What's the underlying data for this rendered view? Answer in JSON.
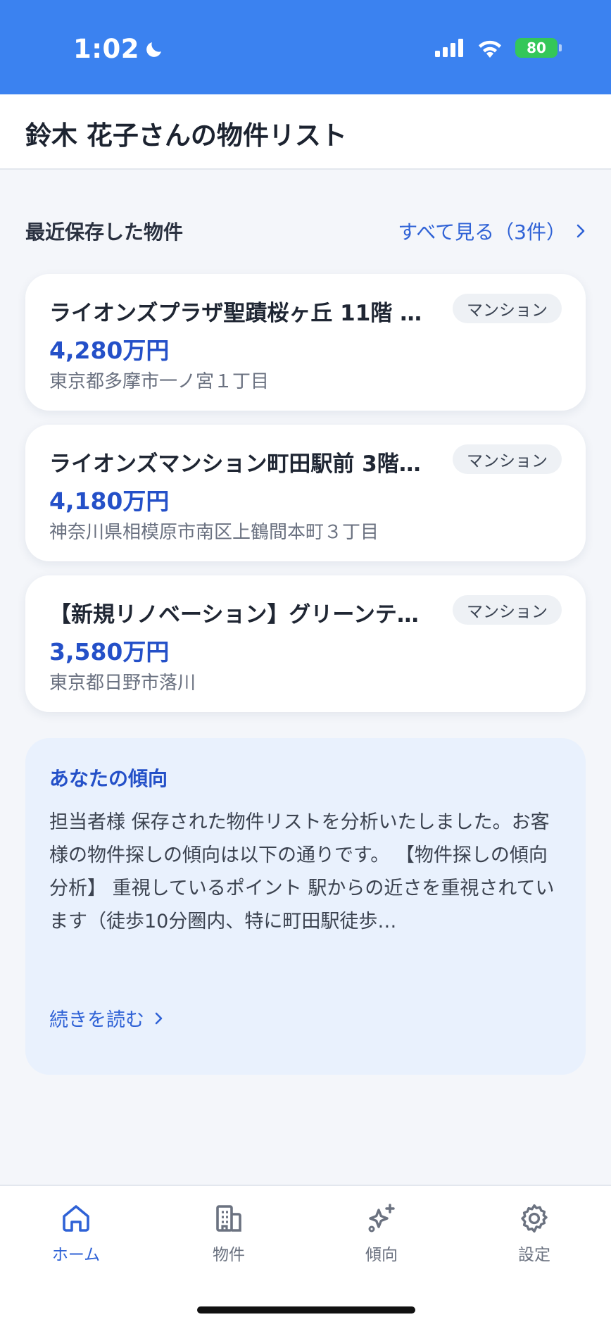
{
  "status_bar": {
    "time": "1:02",
    "battery": "80"
  },
  "header": {
    "title": "鈴木 花子さんの物件リスト"
  },
  "recent": {
    "title": "最近保存した物件",
    "see_all": "すべて見る（3件）",
    "items": [
      {
        "title": "ライオンズプラザ聖蹟桜ヶ丘 11階 …",
        "badge": "マンション",
        "price": "4,280万円",
        "address": "東京都多摩市一ノ宮１丁目"
      },
      {
        "title": "ライオンズマンション町田駅前 3階…",
        "badge": "マンション",
        "price": "4,180万円",
        "address": "神奈川県相模原市南区上鶴間本町３丁目"
      },
      {
        "title": "【新規リノベーション】グリーンテ…",
        "badge": "マンション",
        "price": "3,580万円",
        "address": "東京都日野市落川"
      }
    ]
  },
  "insight": {
    "title": "あなたの傾向",
    "body": "担当者様 保存された物件リストを分析いたしました。お客様の物件探しの傾向は以下の通りです。 【物件探しの傾向分析】 重視しているポイント 駅からの近さを重視されています（徒歩10分圏内、特に町田駅徒歩…",
    "read_more": "続きを読む"
  },
  "tabs": [
    {
      "label": "ホーム",
      "icon": "home-icon",
      "active": true
    },
    {
      "label": "物件",
      "icon": "building-icon",
      "active": false
    },
    {
      "label": "傾向",
      "icon": "sparkle-icon",
      "active": false
    },
    {
      "label": "設定",
      "icon": "gear-icon",
      "active": false
    }
  ],
  "colors": {
    "accent": "#3b82f0",
    "price": "#2450c8",
    "link": "#2f62d6",
    "insight_bg": "#e9f1fd"
  }
}
